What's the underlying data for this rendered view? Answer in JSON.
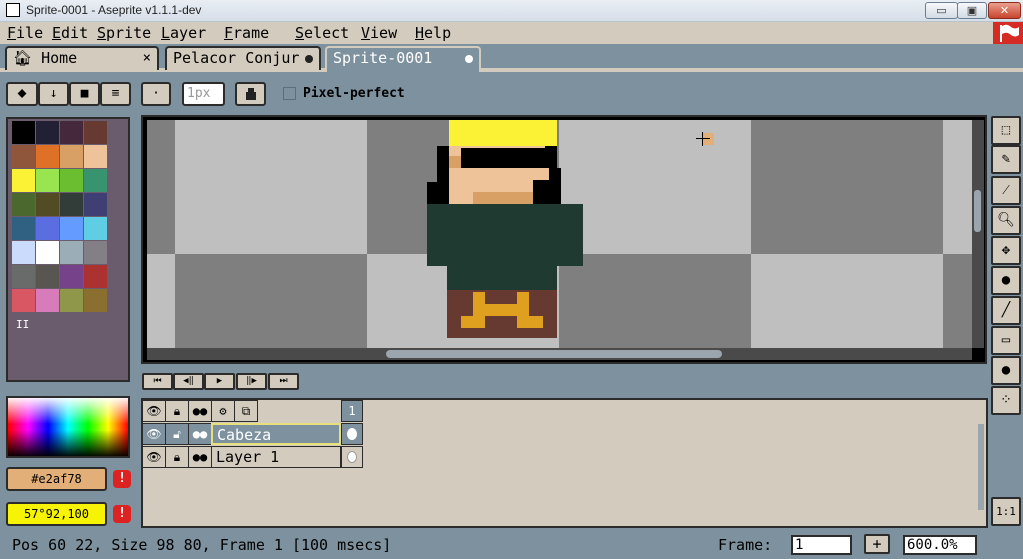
{
  "window": {
    "title": "Sprite-0001 - Aseprite v1.1.1-dev",
    "buttons": {
      "minimize": "▭",
      "maximize": "▣",
      "close": "✕"
    }
  },
  "menu": {
    "items": [
      "File",
      "Edit",
      "Sprite",
      "Layer",
      "Frame",
      "Select",
      "View",
      "Help"
    ]
  },
  "tabs": [
    {
      "label": "Home",
      "icon": "home-icon",
      "closable": true,
      "close": "×"
    },
    {
      "label": "Pelacor Conjur",
      "modified": true
    },
    {
      "label": "Sprite-0001",
      "modified": true,
      "active": true
    }
  ],
  "brush_toolbar": {
    "brush_types": [
      "eraser-brush",
      "down-arrow",
      "folder",
      "menu"
    ],
    "brush_shape": "·",
    "brush_size": "1px",
    "ink_icon": "ink-icon",
    "pixel_perfect_label": "Pixel-perfect",
    "pixel_perfect_checked": false
  },
  "palette": {
    "colors": [
      "#000000",
      "#222034",
      "#45283c",
      "#663931",
      "#8f563b",
      "#df7126",
      "#d9a066",
      "#eec39a",
      "#fbf236",
      "#99e550",
      "#6abe30",
      "#37946e",
      "#4b692f",
      "#524b24",
      "#323c39",
      "#3f3f74",
      "#306082",
      "#5b6ee1",
      "#639bff",
      "#5fcde4",
      "#cbdbfc",
      "#ffffff",
      "#9badb7",
      "#847e87",
      "#696a6a",
      "#595652",
      "#76428a",
      "#ac3232",
      "#d95763",
      "#d77bba",
      "#8f974a",
      "#8a6f30"
    ],
    "pause_marker": "II"
  },
  "colors": {
    "foreground": {
      "label": "#e2af78",
      "value": "#e2af78"
    },
    "background": {
      "label": "57°92,100",
      "value": "#f7f304"
    },
    "warning": "!",
    "accent_red": "#d62a24"
  },
  "player": [
    "⏮",
    "◀‖",
    "▶",
    "‖▶",
    "⏭"
  ],
  "timeline": {
    "header_icons": [
      "eye-icon",
      "lock-icon",
      "onion-icon",
      "gear-icon",
      "layers-icon"
    ],
    "frame_number": "1",
    "layers": [
      {
        "name": "Cabeza",
        "selected": true
      },
      {
        "name": "Layer 1",
        "selected": false
      }
    ]
  },
  "tools": [
    "rect-select-icon",
    "pencil-icon",
    "eyedropper-icon",
    "zoom-icon",
    "move-icon",
    "fill-icon",
    "line-icon",
    "rectangle-icon",
    "blur-icon",
    "spray-icon"
  ],
  "zoom_fit_button": "1:1",
  "status": {
    "text": "Pos 60 22, Size 98 80, Frame 1 [100 msecs]",
    "frame_label": "Frame:",
    "frame_value": "1",
    "add_frame": "+",
    "zoom": "600.0%"
  }
}
